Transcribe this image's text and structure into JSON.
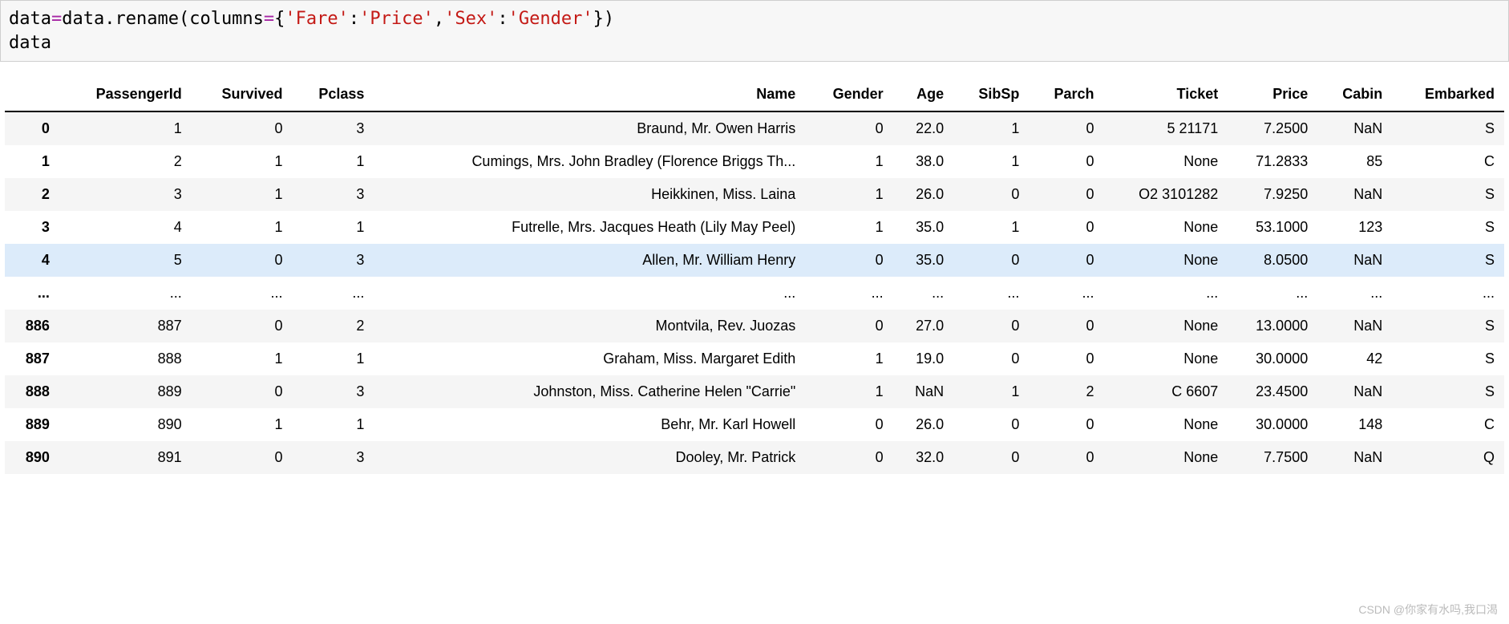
{
  "code": {
    "line1_parts": {
      "p1": "data",
      "op1": "=",
      "p2": "data",
      "dot": ".",
      "fn": "rename",
      "lp": "(",
      "arg": "columns",
      "eq": "=",
      "lb": "{",
      "s1": "'Fare'",
      "colon1": ":",
      "s2": "'Price'",
      "comma": ",",
      "s3": "'Sex'",
      "colon2": ":",
      "s4": "'Gender'",
      "rb": "}",
      "rp": ")"
    },
    "line2": "data"
  },
  "table": {
    "columns": [
      "PassengerId",
      "Survived",
      "Pclass",
      "Name",
      "Gender",
      "Age",
      "SibSp",
      "Parch",
      "Ticket",
      "Price",
      "Cabin",
      "Embarked"
    ],
    "rows": [
      {
        "idx": "0",
        "PassengerId": "1",
        "Survived": "0",
        "Pclass": "3",
        "Name": "Braund, Mr. Owen Harris",
        "Gender": "0",
        "Age": "22.0",
        "SibSp": "1",
        "Parch": "0",
        "Ticket": "5 21171",
        "Price": "7.2500",
        "Cabin": "NaN",
        "Embarked": "S",
        "hl": false
      },
      {
        "idx": "1",
        "PassengerId": "2",
        "Survived": "1",
        "Pclass": "1",
        "Name": "Cumings, Mrs. John Bradley (Florence Briggs Th...",
        "Gender": "1",
        "Age": "38.0",
        "SibSp": "1",
        "Parch": "0",
        "Ticket": "None",
        "Price": "71.2833",
        "Cabin": "85",
        "Embarked": "C",
        "hl": false
      },
      {
        "idx": "2",
        "PassengerId": "3",
        "Survived": "1",
        "Pclass": "3",
        "Name": "Heikkinen, Miss. Laina",
        "Gender": "1",
        "Age": "26.0",
        "SibSp": "0",
        "Parch": "0",
        "Ticket": "O2 3101282",
        "Price": "7.9250",
        "Cabin": "NaN",
        "Embarked": "S",
        "hl": false
      },
      {
        "idx": "3",
        "PassengerId": "4",
        "Survived": "1",
        "Pclass": "1",
        "Name": "Futrelle, Mrs. Jacques Heath (Lily May Peel)",
        "Gender": "1",
        "Age": "35.0",
        "SibSp": "1",
        "Parch": "0",
        "Ticket": "None",
        "Price": "53.1000",
        "Cabin": "123",
        "Embarked": "S",
        "hl": false
      },
      {
        "idx": "4",
        "PassengerId": "5",
        "Survived": "0",
        "Pclass": "3",
        "Name": "Allen, Mr. William Henry",
        "Gender": "0",
        "Age": "35.0",
        "SibSp": "0",
        "Parch": "0",
        "Ticket": "None",
        "Price": "8.0500",
        "Cabin": "NaN",
        "Embarked": "S",
        "hl": true
      },
      {
        "idx": "...",
        "PassengerId": "...",
        "Survived": "...",
        "Pclass": "...",
        "Name": "...",
        "Gender": "...",
        "Age": "...",
        "SibSp": "...",
        "Parch": "...",
        "Ticket": "...",
        "Price": "...",
        "Cabin": "...",
        "Embarked": "...",
        "hl": false
      },
      {
        "idx": "886",
        "PassengerId": "887",
        "Survived": "0",
        "Pclass": "2",
        "Name": "Montvila, Rev. Juozas",
        "Gender": "0",
        "Age": "27.0",
        "SibSp": "0",
        "Parch": "0",
        "Ticket": "None",
        "Price": "13.0000",
        "Cabin": "NaN",
        "Embarked": "S",
        "hl": false
      },
      {
        "idx": "887",
        "PassengerId": "888",
        "Survived": "1",
        "Pclass": "1",
        "Name": "Graham, Miss. Margaret Edith",
        "Gender": "1",
        "Age": "19.0",
        "SibSp": "0",
        "Parch": "0",
        "Ticket": "None",
        "Price": "30.0000",
        "Cabin": "42",
        "Embarked": "S",
        "hl": false
      },
      {
        "idx": "888",
        "PassengerId": "889",
        "Survived": "0",
        "Pclass": "3",
        "Name": "Johnston, Miss. Catherine Helen \"Carrie\"",
        "Gender": "1",
        "Age": "NaN",
        "SibSp": "1",
        "Parch": "2",
        "Ticket": "C 6607",
        "Price": "23.4500",
        "Cabin": "NaN",
        "Embarked": "S",
        "hl": false
      },
      {
        "idx": "889",
        "PassengerId": "890",
        "Survived": "1",
        "Pclass": "1",
        "Name": "Behr, Mr. Karl Howell",
        "Gender": "0",
        "Age": "26.0",
        "SibSp": "0",
        "Parch": "0",
        "Ticket": "None",
        "Price": "30.0000",
        "Cabin": "148",
        "Embarked": "C",
        "hl": false
      },
      {
        "idx": "890",
        "PassengerId": "891",
        "Survived": "0",
        "Pclass": "3",
        "Name": "Dooley, Mr. Patrick",
        "Gender": "0",
        "Age": "32.0",
        "SibSp": "0",
        "Parch": "0",
        "Ticket": "None",
        "Price": "7.7500",
        "Cabin": "NaN",
        "Embarked": "Q",
        "hl": false
      }
    ]
  },
  "watermark": "CSDN @你家有水吗,我口渴"
}
